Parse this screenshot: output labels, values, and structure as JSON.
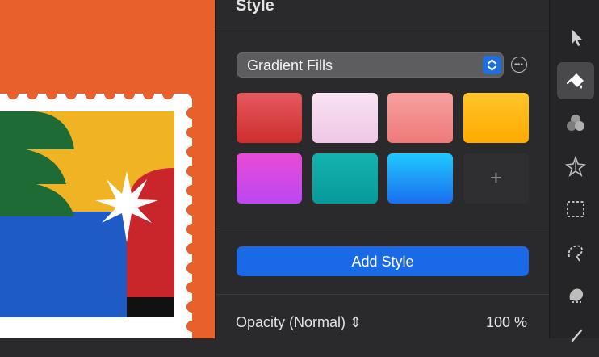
{
  "panel": {
    "title": "Style",
    "dropdown": {
      "selected": "Gradient Fills"
    },
    "swatches": [
      {
        "name": "red",
        "top": "#e45a5f",
        "bottom": "#cf2d2d"
      },
      {
        "name": "light-pink",
        "top": "#f8e3f3",
        "bottom": "#f0c6e5"
      },
      {
        "name": "salmon",
        "top": "#f7a0a0",
        "bottom": "#ee7a78"
      },
      {
        "name": "yellow",
        "top": "#ffc52a",
        "bottom": "#ffaa00"
      },
      {
        "name": "magenta",
        "top": "#e94bd5",
        "bottom": "#bb47f2"
      },
      {
        "name": "teal",
        "top": "#15b3b0",
        "bottom": "#069a9a"
      },
      {
        "name": "blue",
        "top": "#20c9ff",
        "bottom": "#1b6ef0"
      }
    ],
    "add_swatch": "+",
    "add_style_label": "Add Style",
    "opacity_label": "Opacity (Normal) ⇕",
    "opacity_value": "100 %"
  },
  "colors": {
    "accent": "#1a6ae8",
    "canvas_bg": "#e8602a",
    "panel_bg": "#2a2a2c"
  }
}
